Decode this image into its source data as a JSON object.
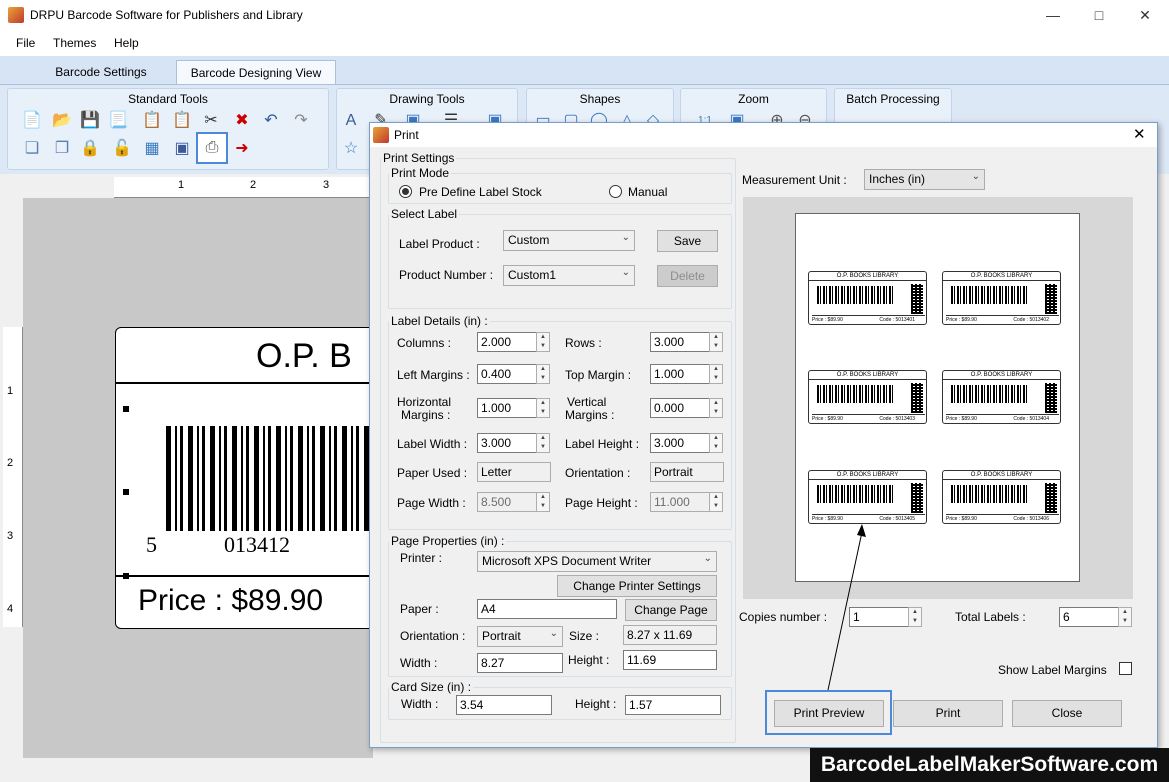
{
  "app": {
    "title": "DRPU Barcode Software for Publishers and Library"
  },
  "menu": [
    "File",
    "Themes",
    "Help"
  ],
  "tabs": [
    "Barcode Settings",
    "Barcode Designing View"
  ],
  "ribbon": {
    "groups": [
      "Standard Tools",
      "Drawing Tools",
      "Shapes",
      "Zoom",
      "Batch Processing"
    ]
  },
  "ruler": {
    "h": [
      "1",
      "2",
      "3"
    ],
    "v": [
      "1",
      "2",
      "3",
      "4"
    ]
  },
  "canvas_label": {
    "title": "O.P. B",
    "digit_left": "5",
    "digit_main": "013412",
    "price": "Price : $89.90"
  },
  "dialog": {
    "title": "Print",
    "print_settings": "Print Settings",
    "print_mode": {
      "legend": "Print Mode",
      "option1": "Pre Define Label Stock",
      "option2": "Manual",
      "selected": "Pre Define Label Stock"
    },
    "select_label": {
      "legend": "Select Label",
      "label_product_lbl": "Label Product :",
      "label_product": "Custom",
      "save": "Save",
      "product_number_lbl": "Product Number :",
      "product_number": "Custom1",
      "delete": "Delete"
    },
    "label_details": {
      "legend": "Label Details (in) :",
      "columns_lbl": "Columns :",
      "columns": "2.000",
      "rows_lbl": "Rows :",
      "rows": "3.000",
      "left_margins_lbl": "Left Margins :",
      "left_margins": "0.400",
      "top_margin_lbl": "Top Margin :",
      "top_margin": "1.000",
      "hmargins_lbl1": "Horizontal",
      "hmargins_lbl2": "Margins :",
      "hmargins": "1.000",
      "vmargins_lbl1": "Vertical",
      "vmargins_lbl2": "Margins :",
      "vmargins": "0.000",
      "label_width_lbl": "Label Width :",
      "label_width": "3.000",
      "label_height_lbl": "Label Height :",
      "label_height": "3.000",
      "paper_used_lbl": "Paper Used :",
      "paper_used": "Letter",
      "orientation_lbl": "Orientation :",
      "orientation": "Portrait",
      "page_width_lbl": "Page Width :",
      "page_width": "8.500",
      "page_height_lbl": "Page Height :",
      "page_height": "11.000"
    },
    "page_properties": {
      "legend": "Page Properties (in) :",
      "printer_lbl": "Printer :",
      "printer": "Microsoft XPS Document Writer",
      "change_printer": "Change Printer Settings",
      "paper_lbl": "Paper :",
      "paper": "A4",
      "change_page": "Change Page",
      "orientation_lbl": "Orientation :",
      "orientation": "Portrait",
      "size_lbl": "Size :",
      "size": "8.27 x 11.69",
      "width_lbl": "Width :",
      "width": "8.27",
      "height_lbl": "Height :",
      "height": "11.69"
    },
    "card_size": {
      "legend": "Card Size (in) :",
      "width_lbl": "Width :",
      "width": "3.54",
      "height_lbl": "Height :",
      "height": "1.57"
    },
    "measurement_unit_lbl": "Measurement Unit :",
    "measurement_unit": "Inches (in)",
    "mini_label": {
      "title": "O.P. BOOKS LIBRARY",
      "price": "Price : $89.90",
      "codes": [
        "Code : 5013401",
        "Code : 5013402",
        "Code : 5013403",
        "Code : 5013404",
        "Code : 5013405",
        "Code : 5013406"
      ]
    },
    "copies_lbl": "Copies number :",
    "copies": "1",
    "total_lbl": "Total Labels :",
    "total": "6",
    "show_margins": "Show Label Margins",
    "buttons": {
      "preview": "Print Preview",
      "print": "Print",
      "close": "Close"
    }
  },
  "watermark": "BarcodeLabelMakerSoftware.com"
}
